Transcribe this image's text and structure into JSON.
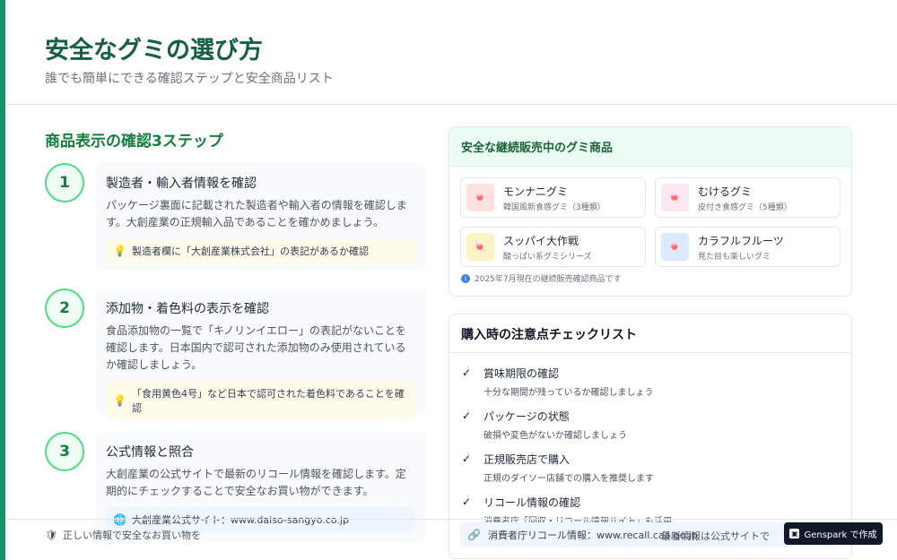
{
  "header": {
    "title": "安全なグミの選び方",
    "subtitle": "誰でも簡単にできる確認ステップと安全商品リスト"
  },
  "steps_section": {
    "title": "商品表示の確認3ステップ",
    "steps": [
      {
        "number": "1",
        "title": "製造者・輸入者情報を確認",
        "description": "パッケージ裏面に記載された製造者や輸入者の情報を確認します。大創産業の正規輸入品であることを確かめましょう。",
        "tip": "製造者欄に「大創産業株式会社」の表記があるか確認",
        "tip_icon": "lightbulb-icon"
      },
      {
        "number": "2",
        "title": "添加物・着色料の表示を確認",
        "description": "食品添加物の一覧で「キノリンイエロー」の表記がないことを確認します。日本国内で認可された添加物のみ使用されているか確認しましょう。",
        "tip": "「食用黄色4号」など日本で認可された着色料であることを確認",
        "tip_icon": "lightbulb-icon"
      },
      {
        "number": "3",
        "title": "公式情報と照合",
        "description": "大創産業の公式サイトで最新のリコール情報を確認します。定期的にチェックすることで安全なお買い物ができます。",
        "tip": "大創産業公式サイト：www.daiso-sangyo.co.jp",
        "tip_icon": "globe-icon"
      }
    ]
  },
  "products_panel": {
    "title": "安全な継続販売中のグミ商品",
    "products": [
      {
        "name": "モンナニグミ",
        "sub": "韓国風新食感グミ（3種類）",
        "icon": "candy-icon",
        "color": "#dc2626"
      },
      {
        "name": "むけるグミ",
        "sub": "皮付き食感グミ（5種類）",
        "icon": "candy-icon",
        "color": "#db2777"
      },
      {
        "name": "スッパイ大作戦",
        "sub": "酸っぱい系グミシリーズ",
        "icon": "candy-icon",
        "color": "#d97706"
      },
      {
        "name": "カラフルフルーツ",
        "sub": "見た目も楽しいグミ",
        "icon": "candy-icon",
        "color": "#2563eb"
      }
    ],
    "note": "2025年7月現在の継続販売確認商品です"
  },
  "checklist_panel": {
    "title": "購入時の注意点チェックリスト",
    "items": [
      {
        "title": "賞味期限の確認",
        "sub": "十分な期間が残っているか確認しましょう"
      },
      {
        "title": "パッケージの状態",
        "sub": "破損や変色がないか確認しましょう"
      },
      {
        "title": "正規販売店で購入",
        "sub": "正規のダイソー店舗での購入を推奨します"
      },
      {
        "title": "リコール情報の確認",
        "sub": "消費者庁「回収・リコール情報サイト」も活用"
      }
    ],
    "recall_link": "消費者庁リコール情報：www.recall.caa.go.jp"
  },
  "footer": {
    "text": "正しい情報で安全なお買い物を",
    "overlay_text": "最新情報は公式サイトで"
  },
  "badge": {
    "label": "Genspark で作成"
  }
}
